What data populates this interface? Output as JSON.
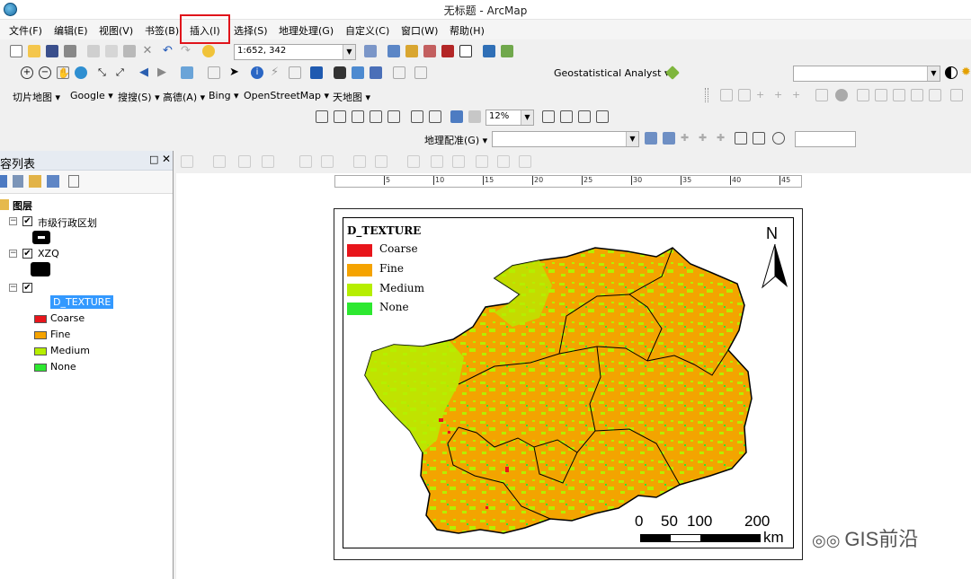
{
  "window": {
    "title": "无标题 - ArcMap"
  },
  "menu": {
    "items": [
      "文件(F)",
      "编辑(E)",
      "视图(V)",
      "书签(B)",
      "插入(I)",
      "选择(S)",
      "地理处理(G)",
      "自定义(C)",
      "窗口(W)",
      "帮助(H)"
    ],
    "highlighted": "插入(I)"
  },
  "toolbar": {
    "scale_value": "1:652, 342",
    "geostat_label": "Geostatistical Analyst",
    "zoom_value": "12%",
    "georef_label": "地理配准(G)",
    "basemap_menus": [
      "切片地图",
      "Google",
      "搜搜(S)",
      "高德(A)",
      "Bing",
      "OpenStreetMap",
      "天地图"
    ]
  },
  "toc": {
    "title": "容列表",
    "root": "图层",
    "layers": [
      {
        "name": "市级行政区划",
        "checked": true
      },
      {
        "name": "XZQ",
        "checked": true
      },
      {
        "name": "",
        "checked": true,
        "field": "D_TEXTURE"
      }
    ],
    "classes": [
      {
        "label": "Coarse",
        "color": "#e8151b"
      },
      {
        "label": "Fine",
        "color": "#f5a300"
      },
      {
        "label": "Medium",
        "color": "#b6ee00"
      },
      {
        "label": "None",
        "color": "#2de830"
      }
    ]
  },
  "ruler": {
    "ticks": [
      "5",
      "10",
      "15",
      "20",
      "25",
      "30",
      "35",
      "40",
      "45"
    ]
  },
  "map": {
    "legend_title": "D_TEXTURE",
    "legend": [
      {
        "label": "Coarse",
        "color": "#e8151b"
      },
      {
        "label": "Fine",
        "color": "#f5a300"
      },
      {
        "label": "Medium",
        "color": "#b6ee00"
      },
      {
        "label": "None",
        "color": "#2de830"
      }
    ],
    "north": "N",
    "scale_labels": [
      "0",
      "50",
      "100",
      "200"
    ],
    "scale_unit": "km"
  },
  "watermark": "GIS前沿"
}
